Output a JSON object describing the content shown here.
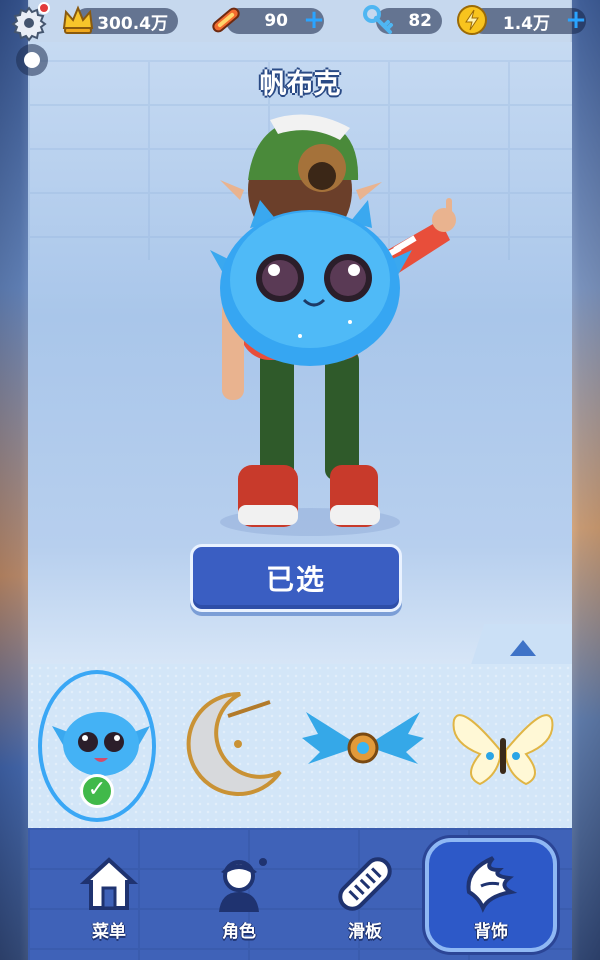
{
  "topbar": {
    "crowns": "300.4万",
    "boards": "90",
    "keys": "82",
    "coins": "1.4万"
  },
  "title": "帆布克",
  "select_button": "已选",
  "nav": [
    {
      "label": "菜单",
      "icon": "home-icon"
    },
    {
      "label": "角色",
      "icon": "character-icon"
    },
    {
      "label": "滑板",
      "icon": "skateboard-icon"
    },
    {
      "label": "背饰",
      "icon": "wings-icon",
      "active": true
    }
  ],
  "items": [
    {
      "icon": "blue-pet-backpack-icon",
      "selected": true
    },
    {
      "icon": "crescent-moon-backpack-icon"
    },
    {
      "icon": "blue-gear-wings-icon"
    },
    {
      "icon": "golden-butterfly-wings-icon"
    }
  ],
  "colors": {
    "accent_blue": "#3a5ec2",
    "nav_bg": "#3f62b8",
    "check_green": "#41b94a",
    "ring_blue": "#3aa7f5"
  }
}
